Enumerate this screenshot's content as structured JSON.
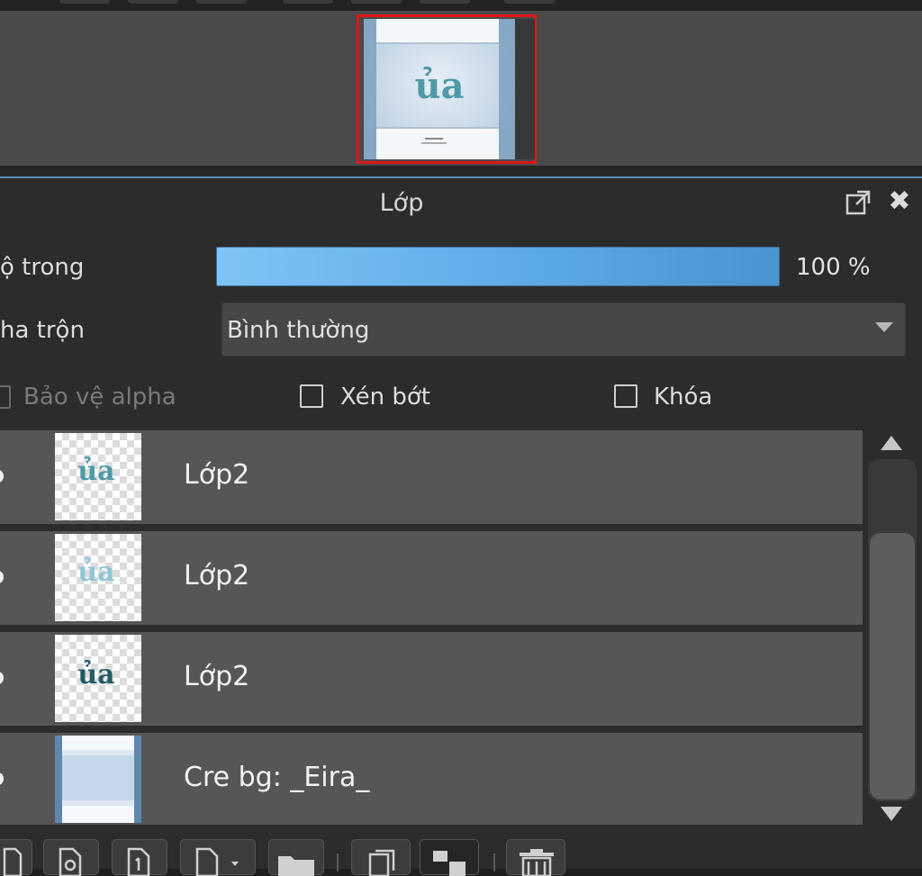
{
  "panel": {
    "title": "Lớp"
  },
  "controls": {
    "opacity_label": "ộ trong",
    "opacity_value": "100 %",
    "opacity_fraction": 1.0,
    "blend_label": "ha trộn",
    "blend_value": "Bình thường",
    "protect_alpha_label": "Bảo vệ alpha",
    "clip_label": "Xén bớt",
    "lock_label": "Khóa"
  },
  "layers": [
    {
      "name": "Lớp2"
    },
    {
      "name": "Lớp2"
    },
    {
      "name": "Lớp2"
    },
    {
      "name": "Cre bg: _Eira_"
    }
  ],
  "colors": {
    "accent": "#5b8fb5",
    "selection_frame": "#e01616",
    "opacity_bar": "#5aa8e4",
    "row_background": "#565656",
    "panel_background": "#2c2c2c"
  },
  "icons": {
    "float": "float-window-icon",
    "close": "close-icon"
  }
}
